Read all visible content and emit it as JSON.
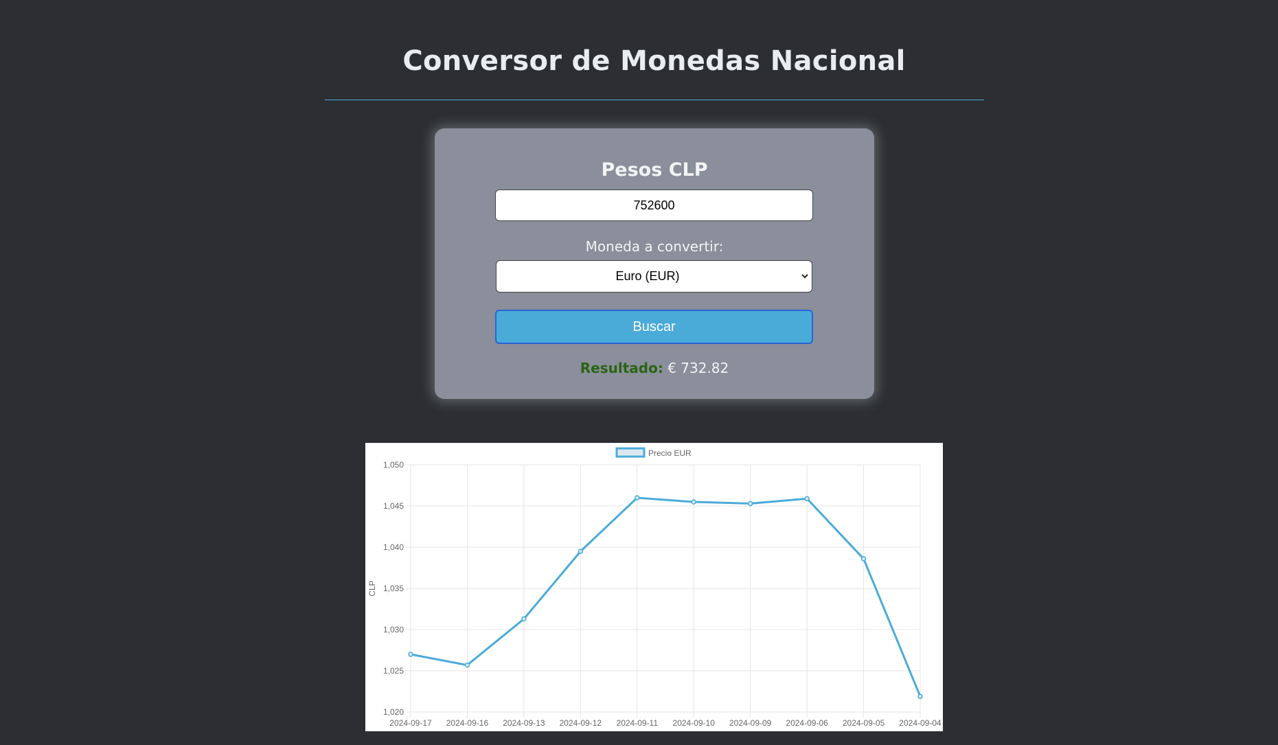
{
  "page": {
    "title": "Conversor de Monedas Nacional"
  },
  "converter": {
    "amount_label": "Pesos CLP",
    "amount_value": "752600",
    "currency_label": "Moneda a convertir:",
    "currency_selected": "Euro (EUR)",
    "search_button": "Buscar",
    "result_label": "Resultado:",
    "result_value": "€ 732.82"
  },
  "colors": {
    "background": "#2c2e32",
    "card": "#8a8f9b",
    "accent": "#4aabd9",
    "result_label": "#2a6414"
  },
  "chart_data": {
    "type": "line",
    "categories": [
      "2024-09-17",
      "2024-09-16",
      "2024-09-13",
      "2024-09-12",
      "2024-09-11",
      "2024-09-10",
      "2024-09-09",
      "2024-09-06",
      "2024-09-05",
      "2024-09-04"
    ],
    "series": [
      {
        "name": "Precio EUR",
        "values": [
          1027.0,
          1025.7,
          1031.3,
          1039.5,
          1046.0,
          1045.5,
          1045.3,
          1045.9,
          1038.6,
          1021.9
        ],
        "color": "#4aabd9"
      }
    ],
    "ylabel": "CLP",
    "xlabel": "",
    "ylim": [
      1020,
      1050
    ],
    "yticks": [
      1020,
      1025,
      1030,
      1035,
      1040,
      1045,
      1050
    ],
    "ytick_labels": [
      "1,020",
      "1,025",
      "1,030",
      "1,035",
      "1,040",
      "1,045",
      "1,050"
    ],
    "grid": true,
    "legend": "top-center"
  }
}
